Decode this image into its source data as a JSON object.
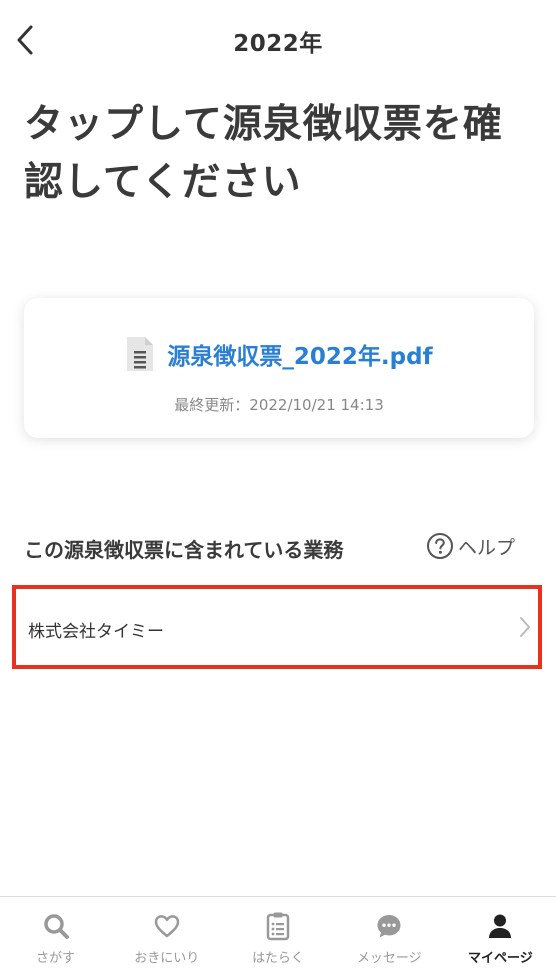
{
  "header": {
    "title": "2022年",
    "back_icon": "chevron-left-icon"
  },
  "headline": "タップして源泉徴収票を確認してください",
  "file_card": {
    "file_name": "源泉徴収票_2022年.pdf",
    "updated_label": "最終更新：",
    "updated_at": "2022/10/21 14:13",
    "icon": "document-icon"
  },
  "section": {
    "title": "この源泉徴収票に含まれている業務",
    "help_label": "ヘルプ",
    "help_icon": "question-circle-icon"
  },
  "companies": [
    {
      "name": "株式会社タイミー"
    }
  ],
  "highlight_color": "#e8321f",
  "link_color": "#2b7fd3",
  "bottom_nav": {
    "items": [
      {
        "label": "さがす",
        "icon": "search-icon",
        "active": false
      },
      {
        "label": "おきにいり",
        "icon": "heart-icon",
        "active": false
      },
      {
        "label": "はたらく",
        "icon": "clipboard-icon",
        "active": false
      },
      {
        "label": "メッセージ",
        "icon": "chat-bubble-icon",
        "active": false
      },
      {
        "label": "マイページ",
        "icon": "person-icon",
        "active": true
      }
    ]
  }
}
